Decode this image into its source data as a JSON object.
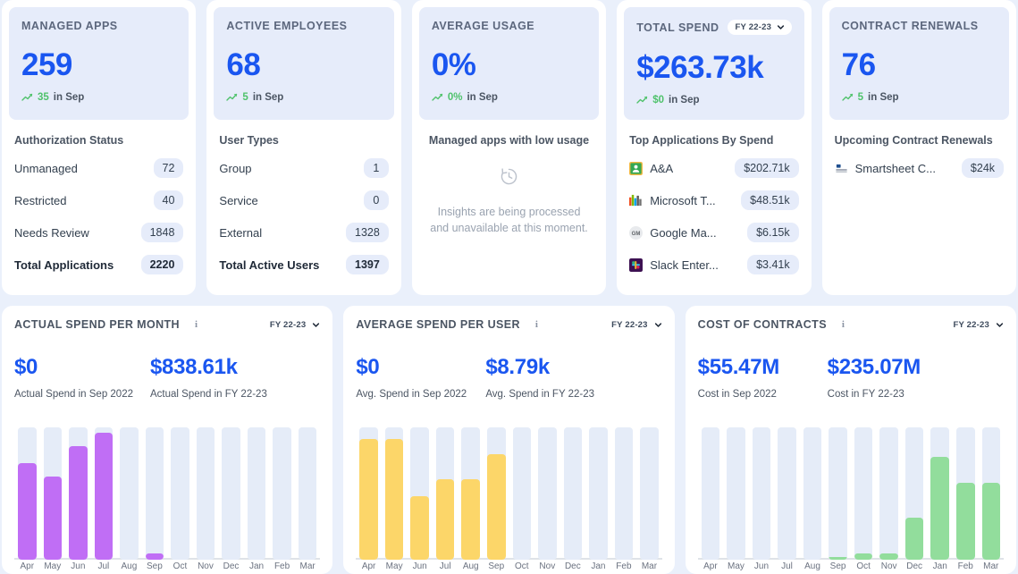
{
  "theme": {
    "page_bg": "#eaf0fb",
    "card_bg": "#ffffff",
    "kpi_head_bg": "#e6ecfa",
    "accent_blue": "#1a56f0",
    "trend_green": "#4fc26b",
    "track_gray": "#e5ecf8",
    "bar_purple": "#c06ef5",
    "bar_yellow": "#fcd669",
    "bar_green": "#92dd9c"
  },
  "kpi_cards": [
    {
      "title": "MANAGED APPS",
      "value": "259",
      "delta_value": "35",
      "delta_period": "in Sep",
      "trend_icon": "trend-up-icon",
      "list_title": "Authorization Status",
      "rows": [
        {
          "label": "Unmanaged",
          "value": "72",
          "total": false
        },
        {
          "label": "Restricted",
          "value": "40",
          "total": false
        },
        {
          "label": "Needs Review",
          "value": "1848",
          "total": false
        },
        {
          "label": "Total Applications",
          "value": "2220",
          "total": true
        }
      ]
    },
    {
      "title": "ACTIVE EMPLOYEES",
      "value": "68",
      "delta_value": "5",
      "delta_period": "in Sep",
      "trend_icon": "trend-up-icon",
      "list_title": "User Types",
      "rows": [
        {
          "label": "Group",
          "value": "1",
          "total": false
        },
        {
          "label": "Service",
          "value": "0",
          "total": false
        },
        {
          "label": "External",
          "value": "1328",
          "total": false
        },
        {
          "label": "Total Active Users",
          "value": "1397",
          "total": true
        }
      ]
    },
    {
      "title": "AVERAGE USAGE",
      "value": "0%",
      "delta_value": "0%",
      "delta_period": "in Sep",
      "trend_icon": "trend-up-icon",
      "list_title": "Managed apps with low usage",
      "empty_icon": "clock-history-icon",
      "empty_message": "Insights are being processed and unavailable at this moment.",
      "rows": []
    },
    {
      "title": "TOTAL SPEND",
      "fy_label": "FY 22-23",
      "fy_icon": "chevron-down-icon",
      "value": "$263.73k",
      "delta_value": "$0",
      "delta_period": "in Sep",
      "trend_icon": "trend-up-icon",
      "list_title": "Top Applications By Spend",
      "rows": [
        {
          "label": "A&A",
          "value": "$202.71k",
          "icon": "ana-app-icon",
          "total": false
        },
        {
          "label": "Microsoft T...",
          "value": "$48.51k",
          "icon": "microsoft-teams-icon",
          "total": false
        },
        {
          "label": "Google Ma...",
          "value": "$6.15k",
          "icon": "google-meet-icon",
          "total": false
        },
        {
          "label": "Slack Enter...",
          "value": "$3.41k",
          "icon": "slack-icon",
          "total": false
        }
      ]
    },
    {
      "title": "CONTRACT RENEWALS",
      "value": "76",
      "delta_value": "5",
      "delta_period": "in Sep",
      "trend_icon": "trend-up-icon",
      "list_title": "Upcoming Contract Renewals",
      "rows": [
        {
          "label": "Smartsheet C...",
          "value": "$24k",
          "icon": "smartsheet-icon",
          "total": false
        }
      ]
    }
  ],
  "chart_panels": [
    {
      "title": "ACTUAL SPEND PER MONTH",
      "info_icon": "info-icon",
      "fy_label": "FY 22-23",
      "fy_icon": "chevron-down-icon",
      "stat_left_value": "$0",
      "stat_left_caption": "Actual Spend in Sep 2022",
      "stat_right_value": "$838.61k",
      "stat_right_caption": "Actual Spend in FY 22-23"
    },
    {
      "title": "AVERAGE SPEND PER USER",
      "info_icon": "info-icon",
      "fy_label": "FY 22-23",
      "fy_icon": "chevron-down-icon",
      "stat_left_value": "$0",
      "stat_left_caption": "Avg. Spend in Sep 2022",
      "stat_right_value": "$8.79k",
      "stat_right_caption": "Avg. Spend in FY 22-23"
    },
    {
      "title": "COST OF CONTRACTS",
      "info_icon": "info-icon",
      "fy_label": "FY 22-23",
      "fy_icon": "chevron-down-icon",
      "stat_left_value": "$55.47M",
      "stat_left_caption": "Cost in Sep 2022",
      "stat_right_value": "$235.07M",
      "stat_right_caption": "Cost in FY 22-23"
    }
  ],
  "chart_data": [
    {
      "type": "bar",
      "title": "ACTUAL SPEND PER MONTH",
      "xlabel": "",
      "ylabel": "",
      "grid": false,
      "legend": "none",
      "bar_color": "#c06ef5",
      "track_color": "#e5ecf8",
      "ymax_pct": 100,
      "categories": [
        "Apr",
        "May",
        "Jun",
        "Jul",
        "Aug",
        "Sep",
        "Oct",
        "Nov",
        "Dec",
        "Jan",
        "Feb",
        "Mar"
      ],
      "values_pct": [
        73,
        63,
        86,
        96,
        0,
        5,
        0,
        0,
        0,
        0,
        0,
        0
      ]
    },
    {
      "type": "bar",
      "title": "AVERAGE SPEND PER USER",
      "xlabel": "",
      "ylabel": "",
      "grid": false,
      "legend": "none",
      "bar_color": "#fcd669",
      "track_color": "#e5ecf8",
      "ymax_pct": 100,
      "categories": [
        "Apr",
        "May",
        "Jun",
        "Jul",
        "Aug",
        "Sep",
        "Oct",
        "Nov",
        "Dec",
        "Jan",
        "Feb",
        "Mar"
      ],
      "values_pct": [
        91,
        91,
        48,
        61,
        61,
        80,
        0,
        0,
        0,
        0,
        0,
        0
      ]
    },
    {
      "type": "bar",
      "title": "COST OF CONTRACTS",
      "xlabel": "",
      "ylabel": "",
      "grid": false,
      "legend": "none",
      "bar_color": "#92dd9c",
      "track_color": "#e5ecf8",
      "ymax_pct": 100,
      "categories": [
        "Apr",
        "May",
        "Jun",
        "Jul",
        "Aug",
        "Sep",
        "Oct",
        "Nov",
        "Dec",
        "Jan",
        "Feb",
        "Mar"
      ],
      "values_pct": [
        0,
        0,
        0,
        0,
        0,
        2,
        5,
        5,
        32,
        78,
        58,
        58
      ]
    }
  ]
}
